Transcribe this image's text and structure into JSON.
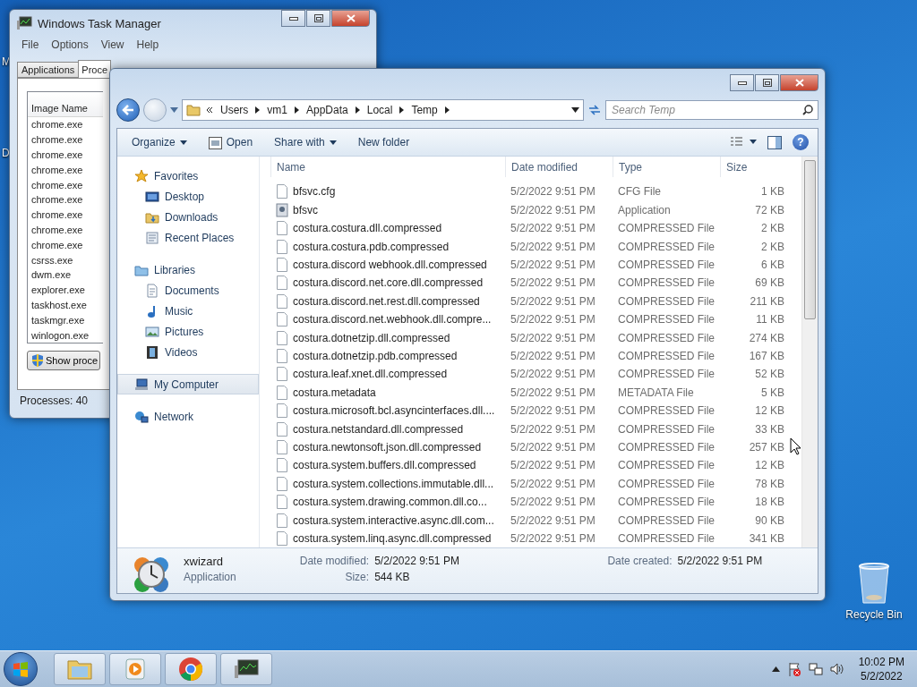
{
  "desktop": {
    "partial_labels": [
      "M",
      "D"
    ],
    "icons": [
      {
        "label": "Recycle Bin",
        "kind": "bin"
      }
    ]
  },
  "task_manager": {
    "title": "Windows Task Manager",
    "menu": [
      "File",
      "Options",
      "View",
      "Help"
    ],
    "tabs": [
      {
        "label": "Applications",
        "selected": false
      },
      {
        "label": "Proce",
        "selected": true
      }
    ],
    "column": "Image Name",
    "processes": [
      "chrome.exe",
      "chrome.exe",
      "chrome.exe",
      "chrome.exe",
      "chrome.exe",
      "chrome.exe",
      "chrome.exe",
      "chrome.exe",
      "chrome.exe",
      "csrss.exe",
      "dwm.exe",
      "explorer.exe",
      "taskhost.exe",
      "taskmgr.exe",
      "winlogon.exe"
    ],
    "button": "Show proce",
    "status": "Processes: 40"
  },
  "explorer": {
    "breadcrumb": [
      "Users",
      "vm1",
      "AppData",
      "Local",
      "Temp"
    ],
    "search": {
      "placeholder": "Search Temp"
    },
    "toolbar": [
      {
        "label": "Organize",
        "kind": "menu"
      },
      {
        "label": "Open",
        "kind": "icon"
      },
      {
        "label": "Share with",
        "kind": "menu"
      },
      {
        "label": "New folder",
        "kind": "plain"
      }
    ],
    "help": "?",
    "nav": [
      {
        "label": "Favorites",
        "kind": "star",
        "selected": false,
        "children": [
          {
            "label": "Desktop",
            "kind": "desktop",
            "selected": false
          },
          {
            "label": "Downloads",
            "kind": "downloads",
            "selected": false
          },
          {
            "label": "Recent Places",
            "kind": "recent",
            "selected": false
          }
        ]
      },
      {
        "label": "Libraries",
        "kind": "library",
        "selected": false,
        "children": [
          {
            "label": "Documents",
            "kind": "documents",
            "selected": false
          },
          {
            "label": "Music",
            "kind": "music",
            "selected": false
          },
          {
            "label": "Pictures",
            "kind": "pictures",
            "selected": false
          },
          {
            "label": "Videos",
            "kind": "videos",
            "selected": false
          }
        ]
      },
      {
        "label": "My Computer",
        "kind": "computer",
        "selected": true
      },
      {
        "label": "Network",
        "kind": "network",
        "selected": false
      }
    ],
    "columns": [
      "Name",
      "Date modified",
      "Type",
      "Size"
    ],
    "files": [
      {
        "name": "bfsvc.cfg",
        "date": "5/2/2022 9:51 PM",
        "type": "CFG File",
        "size": "1 KB",
        "kind": "doc"
      },
      {
        "name": "bfsvc",
        "date": "5/2/2022 9:51 PM",
        "type": "Application",
        "size": "72 KB",
        "kind": "app"
      },
      {
        "name": "costura.costura.dll.compressed",
        "date": "5/2/2022 9:51 PM",
        "type": "COMPRESSED File",
        "size": "2 KB",
        "kind": "doc"
      },
      {
        "name": "costura.costura.pdb.compressed",
        "date": "5/2/2022 9:51 PM",
        "type": "COMPRESSED File",
        "size": "2 KB",
        "kind": "doc"
      },
      {
        "name": "costura.discord webhook.dll.compressed",
        "date": "5/2/2022 9:51 PM",
        "type": "COMPRESSED File",
        "size": "6 KB",
        "kind": "doc"
      },
      {
        "name": "costura.discord.net.core.dll.compressed",
        "date": "5/2/2022 9:51 PM",
        "type": "COMPRESSED File",
        "size": "69 KB",
        "kind": "doc"
      },
      {
        "name": "costura.discord.net.rest.dll.compressed",
        "date": "5/2/2022 9:51 PM",
        "type": "COMPRESSED File",
        "size": "211 KB",
        "kind": "doc"
      },
      {
        "name": "costura.discord.net.webhook.dll.compre...",
        "date": "5/2/2022 9:51 PM",
        "type": "COMPRESSED File",
        "size": "11 KB",
        "kind": "doc"
      },
      {
        "name": "costura.dotnetzip.dll.compressed",
        "date": "5/2/2022 9:51 PM",
        "type": "COMPRESSED File",
        "size": "274 KB",
        "kind": "doc"
      },
      {
        "name": "costura.dotnetzip.pdb.compressed",
        "date": "5/2/2022 9:51 PM",
        "type": "COMPRESSED File",
        "size": "167 KB",
        "kind": "doc"
      },
      {
        "name": "costura.leaf.xnet.dll.compressed",
        "date": "5/2/2022 9:51 PM",
        "type": "COMPRESSED File",
        "size": "52 KB",
        "kind": "doc"
      },
      {
        "name": "costura.metadata",
        "date": "5/2/2022 9:51 PM",
        "type": "METADATA File",
        "size": "5 KB",
        "kind": "doc"
      },
      {
        "name": "costura.microsoft.bcl.asyncinterfaces.dll....",
        "date": "5/2/2022 9:51 PM",
        "type": "COMPRESSED File",
        "size": "12 KB",
        "kind": "doc"
      },
      {
        "name": "costura.netstandard.dll.compressed",
        "date": "5/2/2022 9:51 PM",
        "type": "COMPRESSED File",
        "size": "33 KB",
        "kind": "doc"
      },
      {
        "name": "costura.newtonsoft.json.dll.compressed",
        "date": "5/2/2022 9:51 PM",
        "type": "COMPRESSED File",
        "size": "257 KB",
        "kind": "doc"
      },
      {
        "name": "costura.system.buffers.dll.compressed",
        "date": "5/2/2022 9:51 PM",
        "type": "COMPRESSED File",
        "size": "12 KB",
        "kind": "doc"
      },
      {
        "name": "costura.system.collections.immutable.dll...",
        "date": "5/2/2022 9:51 PM",
        "type": "COMPRESSED File",
        "size": "78 KB",
        "kind": "doc"
      },
      {
        "name": "costura.system.drawing.common.dll.co...",
        "date": "5/2/2022 9:51 PM",
        "type": "COMPRESSED File",
        "size": "18 KB",
        "kind": "doc"
      },
      {
        "name": "costura.system.interactive.async.dll.com...",
        "date": "5/2/2022 9:51 PM",
        "type": "COMPRESSED File",
        "size": "90 KB",
        "kind": "doc"
      },
      {
        "name": "costura.system.linq.async.dll.compressed",
        "date": "5/2/2022 9:51 PM",
        "type": "COMPRESSED File",
        "size": "341 KB",
        "kind": "doc"
      }
    ],
    "details": {
      "name": "xwizard",
      "type": "Application",
      "modified_label": "Date modified:",
      "modified": "5/2/2022 9:51 PM",
      "created_label": "Date created:",
      "created": "5/2/2022 9:51 PM",
      "size_label": "Size:",
      "size": "544 KB"
    }
  },
  "taskbar": {
    "apps": [
      {
        "kind": "folder"
      },
      {
        "kind": "media"
      },
      {
        "kind": "chrome"
      },
      {
        "kind": "taskmgr"
      }
    ],
    "clock": {
      "time": "10:02 PM",
      "date": "5/2/2022"
    }
  }
}
